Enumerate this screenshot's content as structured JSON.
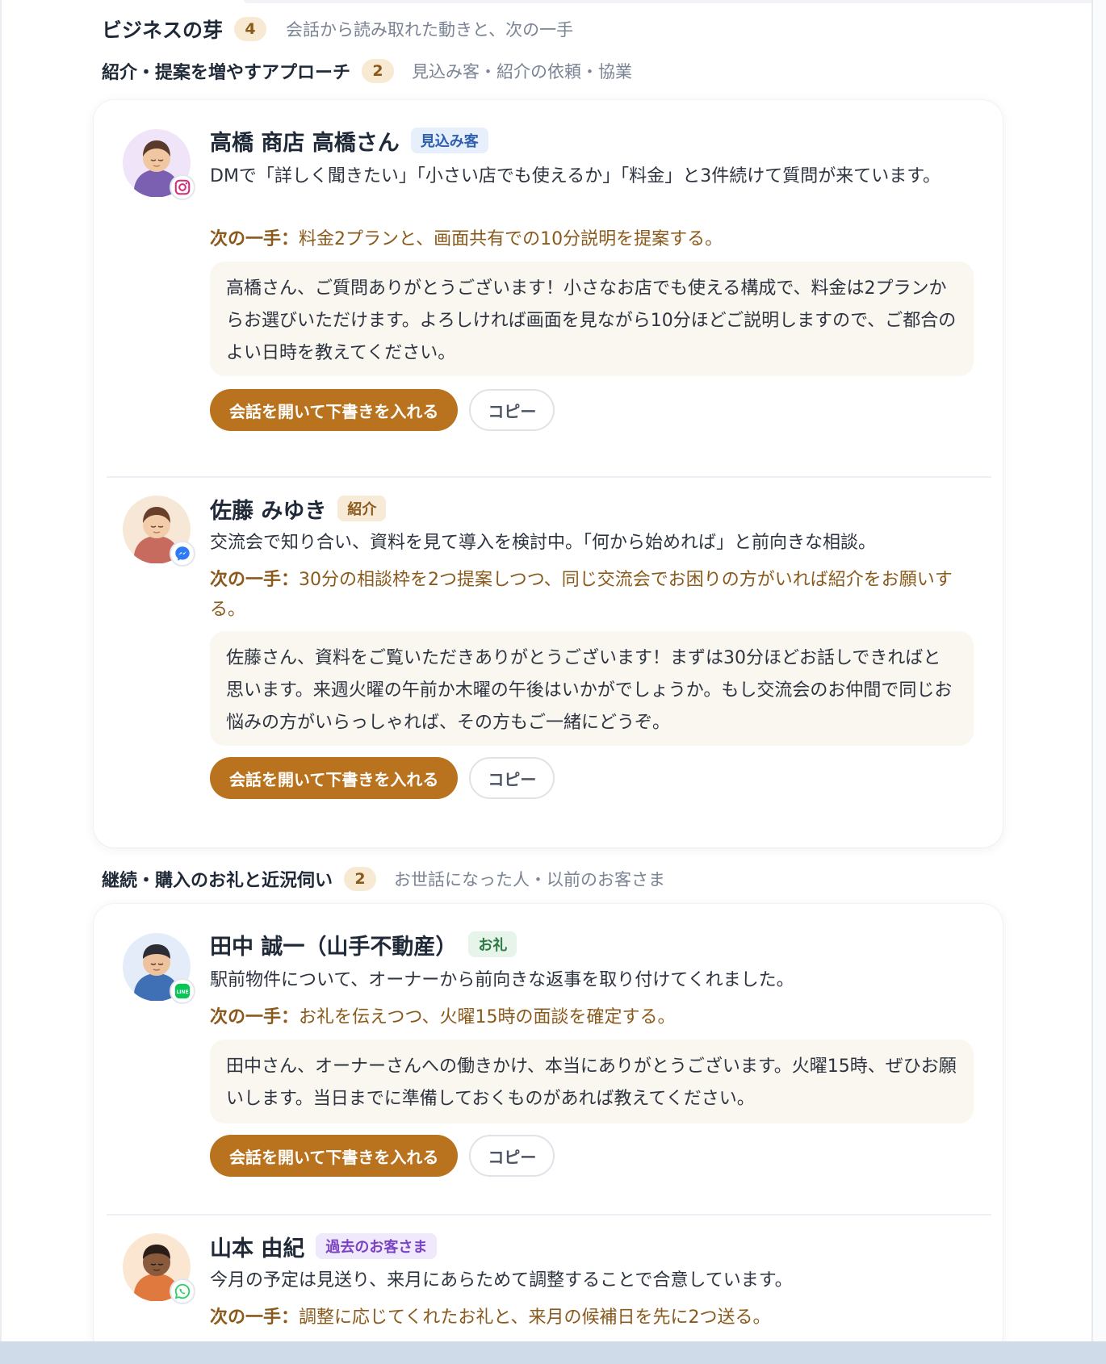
{
  "section": {
    "title": "ビジネスの芽",
    "count": "4",
    "subtitle": "会話から読み取れた動きと、次の一手"
  },
  "groups": [
    {
      "title": "紹介・提案を増やすアプローチ",
      "count": "2",
      "subtitle": "見込み客・紹介の依頼・協業",
      "entries": [
        {
          "name": "高橋 商店 高橋さん",
          "tag": "見込み客",
          "channel": "instagram-icon",
          "description": "DMで「詳しく聞きたい」「小さい店でも使えるか」「料金」と3件続けて質問が来ています。",
          "next_label": "次の一手：",
          "next_text": "料金2プランと、画面共有での10分説明を提案する。",
          "draft": "高橋さん、ご質問ありがとうございます！小さなお店でも使える構成で、料金は2プランからお選びいただけます。よろしければ画面を見ながら10分ほどご説明しますので、ご都合のよい日時を教えてください。",
          "primary_button": "会話を開いて下書きを入れる",
          "copy_button": "コピー"
        },
        {
          "name": "佐藤 みゆき",
          "tag": "紹介",
          "channel": "messenger-icon",
          "description": "交流会で知り合い、資料を見て導入を検討中。「何から始めれば」と前向きな相談。",
          "next_label": "次の一手：",
          "next_text": "30分の相談枠を2つ提案しつつ、同じ交流会でお困りの方がいれば紹介をお願いする。",
          "draft": "佐藤さん、資料をご覧いただきありがとうございます！まずは30分ほどお話しできればと思います。来週火曜の午前か木曜の午後はいかがでしょうか。もし交流会のお仲間で同じお悩みの方がいらっしゃれば、その方もご一緒にどうぞ。",
          "primary_button": "会話を開いて下書きを入れる",
          "copy_button": "コピー"
        }
      ]
    },
    {
      "title": "継続・購入のお礼と近況伺い",
      "count": "2",
      "subtitle": "お世話になった人・以前のお客さま",
      "entries": [
        {
          "name": "田中 誠一（山手不動産）",
          "tag": "お礼",
          "channel": "line-icon",
          "channel_text": "LINE",
          "description": "駅前物件について、オーナーから前向きな返事を取り付けてくれました。",
          "next_label": "次の一手：",
          "next_text": "お礼を伝えつつ、火曜15時の面談を確定する。",
          "draft": "田中さん、オーナーさんへの働きかけ、本当にありがとうございます。火曜15時、ぜひお願いします。当日までに準備しておくものがあれば教えてください。",
          "primary_button": "会話を開いて下書きを入れる",
          "copy_button": "コピー"
        },
        {
          "name": "山本 由紀",
          "tag": "過去のお客さま",
          "channel": "whatsapp-icon",
          "description": "今月の予定は見送り、来月にあらためて調整することで合意しています。",
          "next_label": "次の一手：",
          "next_text": "調整に応じてくれたお礼と、来月の候補日を先に2つ送る。"
        }
      ]
    }
  ],
  "colors": {
    "accent": "#b9731e",
    "next_text": "#8a5a1c",
    "draft_bg": "#faf7f1"
  }
}
